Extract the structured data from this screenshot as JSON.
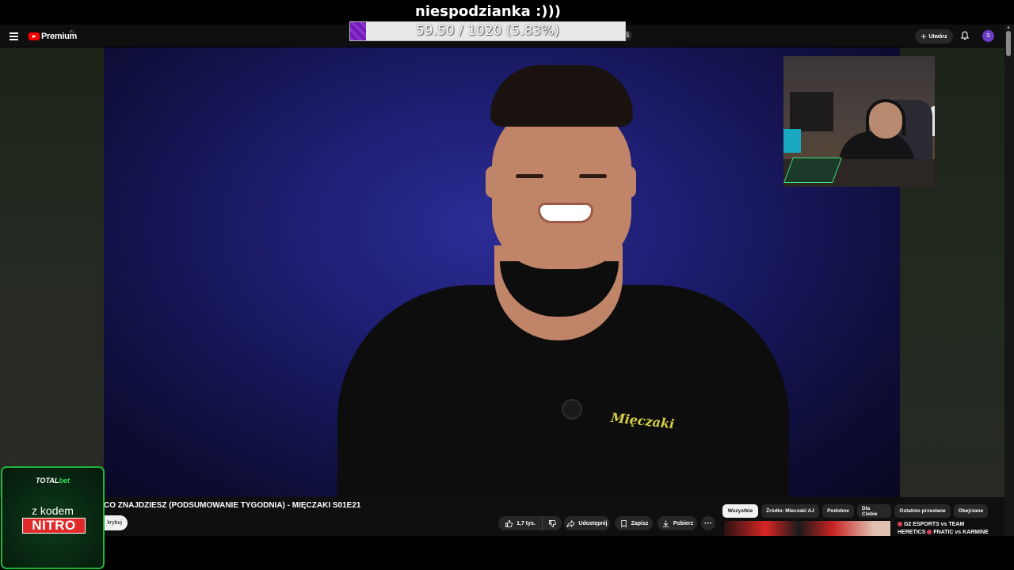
{
  "stream_overlay": {
    "goal_title": "niespodzianka :)))",
    "goal_text": "59.50 / 1020 (5.83%)",
    "goal_progress": 0.0583,
    "goal_fill_color": "#8e2fd1"
  },
  "youtube": {
    "brand": "Premium",
    "region": "PL",
    "create_label": "Utwórz",
    "avatar_letter": "S",
    "video": {
      "title": "CO ZNAJDZIESZ (PODSUMOWANIE TYGODNIA) - MIĘCZAKI S01E21",
      "subscribe_label": "krybuj",
      "shirt_logo": "Mięczaki",
      "likes": "1,7 tys.",
      "share_label": "Udostępnij",
      "save_label": "Zapisz",
      "download_label": "Pobierz",
      "more_label": "···"
    },
    "chips": [
      {
        "label": "Wszystkie",
        "active": true
      },
      {
        "label": "Źródło: Mieczaki AJ",
        "active": false
      },
      {
        "label": "Podobne",
        "active": false
      },
      {
        "label": "Dla Ciebie",
        "active": false
      },
      {
        "label": "Ostatnio przesłane",
        "active": false
      },
      {
        "label": "Obejrzane",
        "active": false
      }
    ],
    "recommendation": {
      "line1": "G2 ESPORTS vs TEAM",
      "line2a": "HERETICS",
      "line2b": "FNATIC vs KARMINE"
    }
  },
  "sponsor": {
    "brand_a": "TOTAL",
    "brand_b": "bet",
    "text": "z kodem",
    "code": "NITRO",
    "accent_color": "#1fb43a"
  },
  "icons": [
    "menu-icon",
    "youtube-logo-icon",
    "mic-icon",
    "plus-icon",
    "bell-icon",
    "like-icon",
    "dislike-icon",
    "share-icon",
    "save-icon",
    "download-icon"
  ]
}
